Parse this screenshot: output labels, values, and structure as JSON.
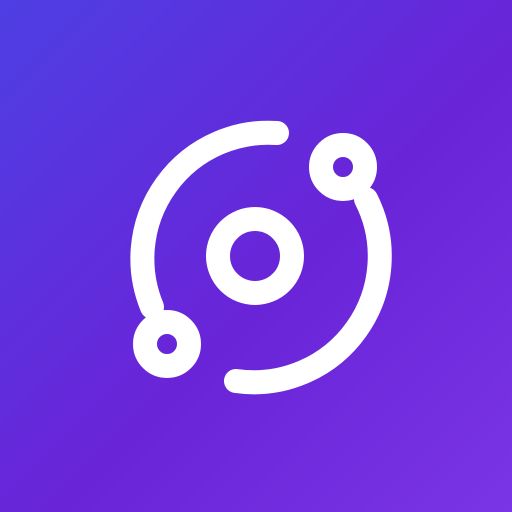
{
  "icon": {
    "name": "orbit-logo-icon",
    "colors": {
      "gradient_start": "#4D3FE3",
      "gradient_mid": "#6A24D8",
      "gradient_end": "#7A35E6",
      "glyph": "#FFFFFF"
    }
  }
}
